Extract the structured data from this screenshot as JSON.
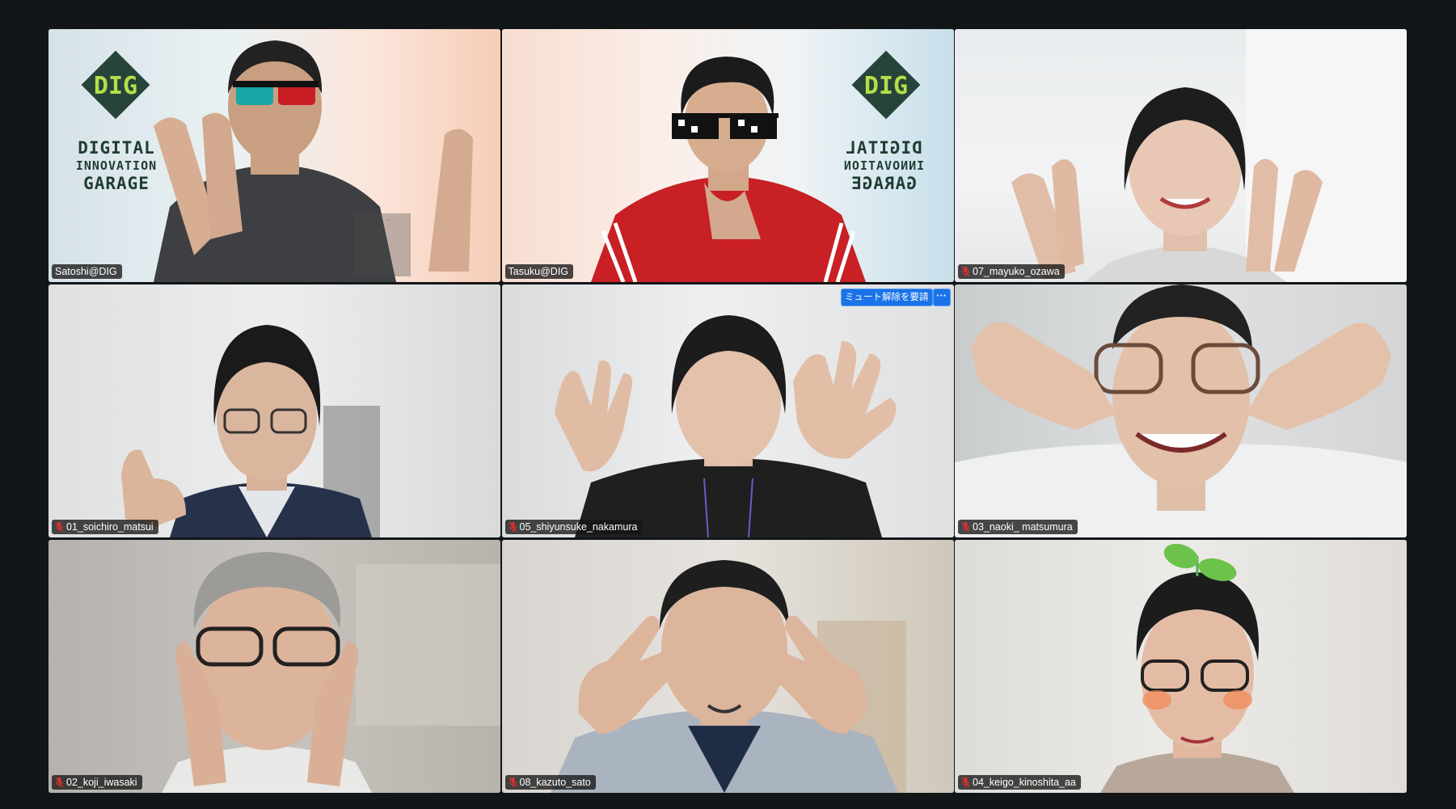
{
  "participants": [
    {
      "name": "Satoshi@DIG",
      "muted": false,
      "active_speaker": false
    },
    {
      "name": "Tasuku@DIG",
      "muted": false,
      "active_speaker": true
    },
    {
      "name": "07_mayuko_ozawa",
      "muted": true,
      "active_speaker": false
    },
    {
      "name": "01_soichiro_matsui",
      "muted": true,
      "active_speaker": false
    },
    {
      "name": "05_shiyunsuke_nakamura",
      "muted": true,
      "active_speaker": false
    },
    {
      "name": "03_naoki_ matsumura",
      "muted": true,
      "active_speaker": false
    },
    {
      "name": "02_koji_iwasaki",
      "muted": true,
      "active_speaker": false
    },
    {
      "name": "08_kazuto_sato",
      "muted": true,
      "active_speaker": false
    },
    {
      "name": "04_keigo_kinoshita_aa",
      "muted": true,
      "active_speaker": false
    }
  ],
  "hover_controls": {
    "request_unmute_label": "ミュート解除を要請",
    "more_label": "···"
  },
  "virtual_background": {
    "logo": "DIG",
    "logo_line1": "DIGITAL",
    "logo_line2": "INNOVATION",
    "logo_line3": "GARAGE",
    "mirrored_line1": "DIGITAL",
    "mirrored_line2": "INNOVATION",
    "mirrored_line3": "GARAGE"
  },
  "colors": {
    "active_speaker_border": "#23a33e",
    "request_button": "#1a73e8",
    "muted_icon": "#e02f2f"
  }
}
